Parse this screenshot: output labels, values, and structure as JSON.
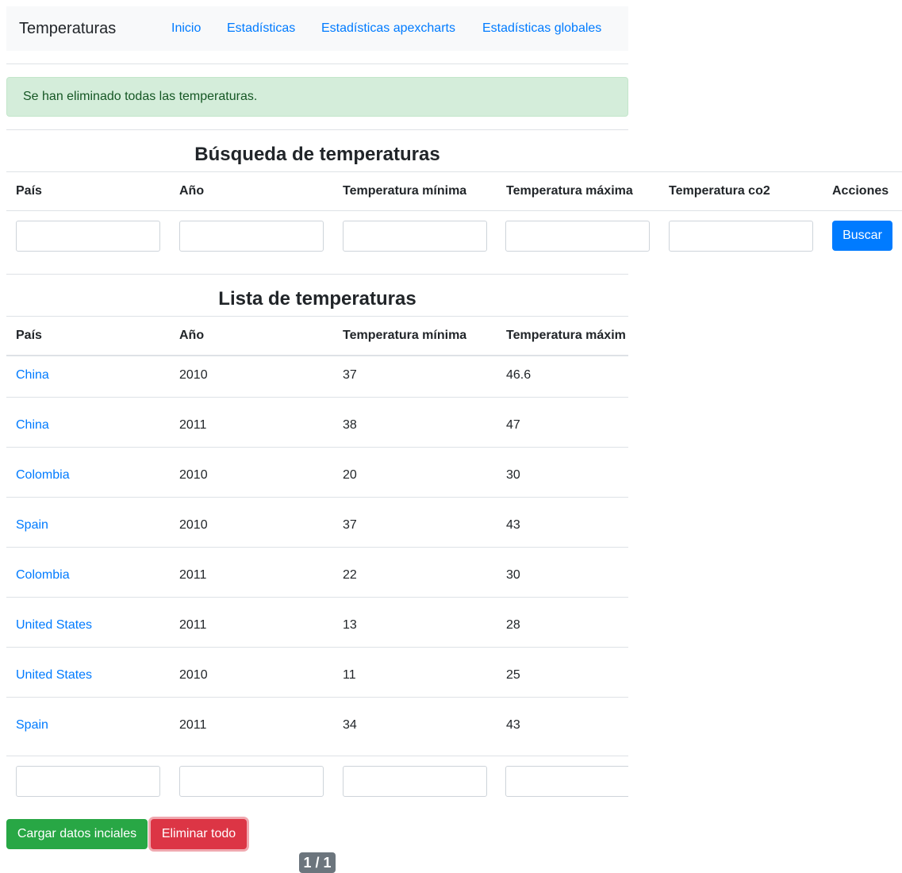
{
  "navbar": {
    "brand": "Temperaturas",
    "links": [
      "Inicio",
      "Estadísticas",
      "Estadísticas apexcharts",
      "Estadísticas globales"
    ]
  },
  "alert": {
    "message": "Se han eliminado todas las temperaturas."
  },
  "search": {
    "title": "Búsqueda de temperaturas",
    "headers": [
      "País",
      "Año",
      "Temperatura mínima",
      "Temperatura máxima",
      "Temperatura co2",
      "Acciones"
    ],
    "button_label": "Buscar"
  },
  "list": {
    "title": "Lista de temperaturas",
    "headers": [
      "País",
      "Año",
      "Temperatura mínima",
      "Temperatura máxim"
    ],
    "rows": [
      {
        "country": "China",
        "year": "2010",
        "min": "37",
        "max": "46.6"
      },
      {
        "country": "China",
        "year": "2011",
        "min": "38",
        "max": "47"
      },
      {
        "country": "Colombia",
        "year": "2010",
        "min": "20",
        "max": "30"
      },
      {
        "country": "Spain",
        "year": "2010",
        "min": "37",
        "max": "43"
      },
      {
        "country": "Colombia",
        "year": "2011",
        "min": "22",
        "max": "30"
      },
      {
        "country": "United States",
        "year": "2011",
        "min": "13",
        "max": "28"
      },
      {
        "country": "United States",
        "year": "2010",
        "min": "11",
        "max": "25"
      },
      {
        "country": "Spain",
        "year": "2011",
        "min": "34",
        "max": "43"
      }
    ]
  },
  "actions": {
    "load_label": "Cargar datos inciales",
    "delete_label": "Eliminar todo"
  },
  "pagination": {
    "label": "1 / 1"
  }
}
